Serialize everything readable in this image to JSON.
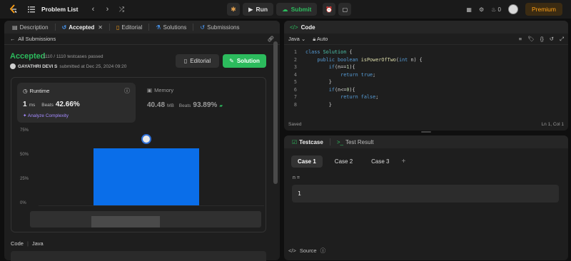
{
  "topbar": {
    "title": "Problem List",
    "run_label": "Run",
    "submit_label": "Submit",
    "streak_count": "0",
    "premium_label": "Premium"
  },
  "left_panel": {
    "tabs": [
      {
        "label": "Description"
      },
      {
        "label": "Accepted"
      },
      {
        "label": "Editorial"
      },
      {
        "label": "Solutions"
      },
      {
        "label": "Submissions"
      }
    ],
    "back_label": "All Submissions",
    "status": "Accepted",
    "testcases": "1110 / 1110 testcases passed",
    "submitter_name": "GAYATHRI DEVI S",
    "submitted_text": "submitted at Dec 25, 2024 09:20",
    "editorial_button": "Editorial",
    "solution_button": "Solution",
    "runtime": {
      "label": "Runtime",
      "value": "1",
      "unit": "ms",
      "beats_label": "Beats",
      "beats_pct": "42.66%",
      "analyze_label": "Analyze Complexity"
    },
    "memory": {
      "label": "Memory",
      "value": "40.48",
      "unit": "MB",
      "beats_label": "Beats",
      "beats_pct": "93.89%"
    },
    "chart_data": {
      "type": "bar",
      "ylim": [
        0,
        75
      ],
      "yticks": [
        "75%",
        "50%",
        "25%",
        "0%"
      ],
      "values": [
        58
      ]
    },
    "code_label": "Code",
    "code_lang": "Java"
  },
  "code_panel": {
    "title": "Code",
    "language": "Java",
    "autosave": "Auto",
    "lines": [
      {
        "no": "1",
        "text": "class Solution {"
      },
      {
        "no": "2",
        "text": "    public boolean isPowerOfTwo(int n) {"
      },
      {
        "no": "3",
        "text": "        if(n==1){"
      },
      {
        "no": "4",
        "text": "            return true;"
      },
      {
        "no": "5",
        "text": "        }"
      },
      {
        "no": "6",
        "text": "        if(n<=0){"
      },
      {
        "no": "7",
        "text": "            return false;"
      },
      {
        "no": "8",
        "text": "        }"
      }
    ],
    "saved_label": "Saved",
    "cursor_pos": "Ln 1, Col 1"
  },
  "test_panel": {
    "testcase_tab": "Testcase",
    "result_tab": "Test Result",
    "cases": [
      {
        "label": "Case 1"
      },
      {
        "label": "Case 2"
      },
      {
        "label": "Case 3"
      }
    ],
    "add_label": "+",
    "input_label": "n =",
    "input_value": "1",
    "source_label": "Source"
  }
}
